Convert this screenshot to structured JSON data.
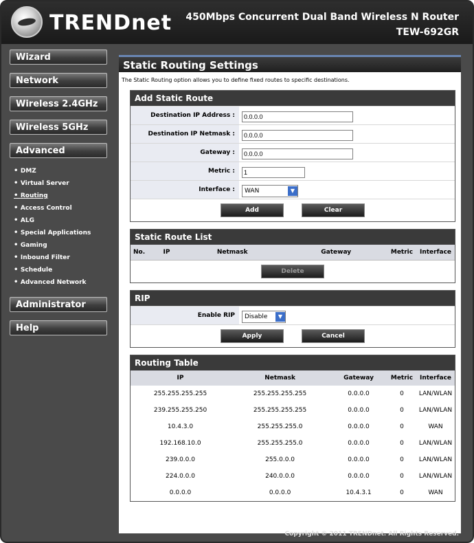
{
  "header": {
    "logo": "TRENDnet",
    "product": "450Mbps Concurrent Dual Band Wireless N Router",
    "model": "TEW-692GR"
  },
  "sidebar": {
    "wizard": "Wizard",
    "network": "Network",
    "wireless24": "Wireless 2.4GHz",
    "wireless5": "Wireless 5GHz",
    "advanced": "Advanced",
    "advanced_items": [
      "DMZ",
      "Virtual Server",
      "Routing",
      "Access Control",
      "ALG",
      "Special Applications",
      "Gaming",
      "Inbound Filter",
      "Schedule",
      "Advanced Network"
    ],
    "administrator": "Administrator",
    "help": "Help"
  },
  "page": {
    "title": "Static Routing Settings",
    "intro": "The Static Routing option allows you to define fixed routes to specific destinations."
  },
  "add_route": {
    "title": "Add Static Route",
    "dest_ip_label": "Destination IP Address :",
    "dest_ip_value": "0.0.0.0",
    "netmask_label": "Destination IP Netmask :",
    "netmask_value": "0.0.0.0",
    "gateway_label": "Gateway :",
    "gateway_value": "0.0.0.0",
    "metric_label": "Metric :",
    "metric_value": "1",
    "interface_label": "Interface :",
    "interface_value": "WAN",
    "add_label": "Add",
    "clear_label": "Clear"
  },
  "route_list": {
    "title": "Static Route List",
    "headers": [
      "No.",
      "IP",
      "Netmask",
      "Gateway",
      "Metric",
      "Interface"
    ],
    "delete_label": "Delete"
  },
  "rip": {
    "title": "RIP",
    "enable_label": "Enable RIP",
    "enable_value": "Disable",
    "apply_label": "Apply",
    "cancel_label": "Cancel"
  },
  "routing_table": {
    "title": "Routing Table",
    "headers": [
      "IP",
      "Netmask",
      "Gateway",
      "Metric",
      "Interface"
    ],
    "rows": [
      [
        "255.255.255.255",
        "255.255.255.255",
        "0.0.0.0",
        "0",
        "LAN/WLAN"
      ],
      [
        "239.255.255.250",
        "255.255.255.255",
        "0.0.0.0",
        "0",
        "LAN/WLAN"
      ],
      [
        "10.4.3.0",
        "255.255.255.0",
        "0.0.0.0",
        "0",
        "WAN"
      ],
      [
        "192.168.10.0",
        "255.255.255.0",
        "0.0.0.0",
        "0",
        "LAN/WLAN"
      ],
      [
        "239.0.0.0",
        "255.0.0.0",
        "0.0.0.0",
        "0",
        "LAN/WLAN"
      ],
      [
        "224.0.0.0",
        "240.0.0.0",
        "0.0.0.0",
        "0",
        "LAN/WLAN"
      ],
      [
        "0.0.0.0",
        "0.0.0.0",
        "10.4.3.1",
        "0",
        "WAN"
      ]
    ]
  },
  "footer": {
    "copyright": "Copyright © 2011 TRENDnet. All Rights Reserved."
  }
}
